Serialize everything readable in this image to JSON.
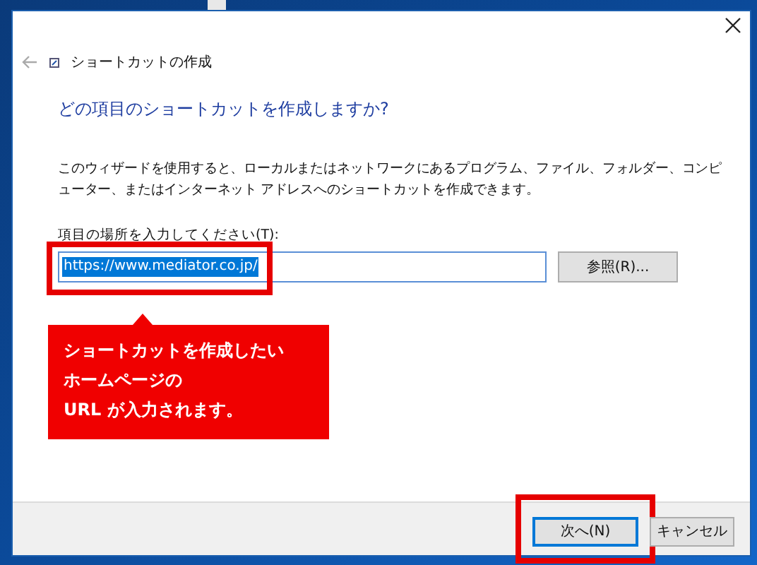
{
  "window": {
    "title": "ショートカットの作成"
  },
  "heading": "どの項目のショートカットを作成しますか?",
  "description": "このウィザードを使用すると、ローカルまたはネットワークにあるプログラム、ファイル、フォルダー、コンピューター、またはインターネット アドレスへのショートカットを作成できます。",
  "location_label": "項目の場所を入力してください(T):",
  "location_field": {
    "value": "https://www.mediator.co.jp/",
    "text_selected": true
  },
  "browse_button": {
    "label": "参照(R)..."
  },
  "footer_buttons": [
    {
      "label": "次へ(N)",
      "default": true,
      "highlighted": true
    },
    {
      "label": "キャンセル",
      "default": false,
      "highlighted": false
    }
  ],
  "callout": {
    "lines": [
      "ショートカットを作成したい",
      "ホームページの",
      "URL が入力されます。"
    ]
  },
  "field_highlighted": true
}
